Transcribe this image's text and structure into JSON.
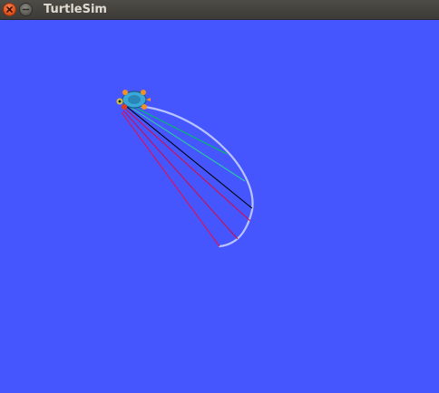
{
  "window": {
    "title": "TurtleSim",
    "controls": [
      "close",
      "minimize"
    ]
  },
  "canvas": {
    "background": "#4556ff",
    "turtle_icon": "turtle-icon",
    "trail_color": "#b8c4ff",
    "line_colors": [
      "#00c060",
      "#2ac8a0",
      "#000000",
      "#d0104a",
      "#e01050"
    ]
  }
}
